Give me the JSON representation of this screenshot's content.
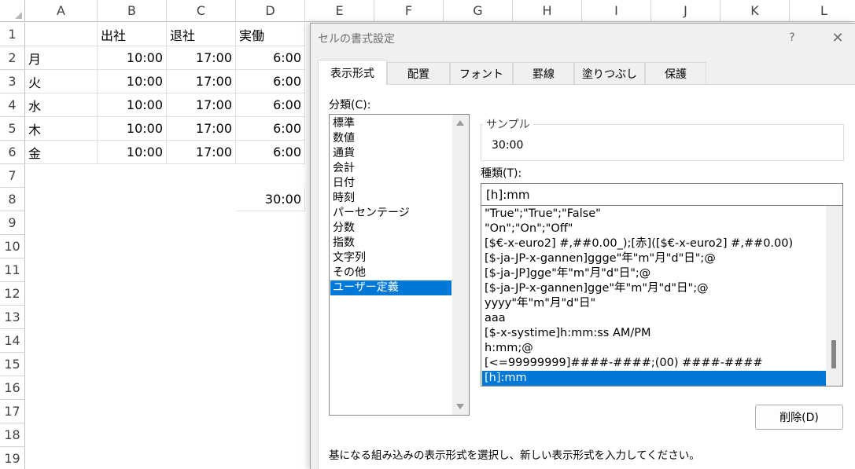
{
  "sheet": {
    "columns": [
      "A",
      "B",
      "C",
      "D",
      "E",
      "F",
      "G",
      "H",
      "I",
      "J",
      "K",
      "L"
    ],
    "rows": [
      "1",
      "2",
      "3",
      "4",
      "5",
      "6",
      "7",
      "8",
      "9",
      "10",
      "11",
      "12",
      "13",
      "14",
      "15",
      "16",
      "17",
      "18",
      "19"
    ],
    "headers": {
      "b": "出社",
      "c": "退社",
      "d": "実働"
    },
    "data": [
      {
        "a": "月",
        "b": "10:00",
        "c": "17:00",
        "d": "6:00"
      },
      {
        "a": "火",
        "b": "10:00",
        "c": "17:00",
        "d": "6:00"
      },
      {
        "a": "水",
        "b": "10:00",
        "c": "17:00",
        "d": "6:00"
      },
      {
        "a": "木",
        "b": "10:00",
        "c": "17:00",
        "d": "6:00"
      },
      {
        "a": "金",
        "b": "10:00",
        "c": "17:00",
        "d": "6:00"
      }
    ],
    "total": "30:00"
  },
  "dialog": {
    "title": "セルの書式設定",
    "help": "?",
    "close": "✕",
    "tabs": [
      "表示形式",
      "配置",
      "フォント",
      "罫線",
      "塗りつぶし",
      "保護"
    ],
    "active_tab": "表示形式",
    "category_label": "分類(C):",
    "categories": [
      "標準",
      "数値",
      "通貨",
      "会計",
      "日付",
      "時刻",
      "パーセンテージ",
      "分数",
      "指数",
      "文字列",
      "その他",
      "ユーザー定義"
    ],
    "selected_category": "ユーザー定義",
    "sample_label": "サンプル",
    "sample_value": "30:00",
    "type_label": "種類(T):",
    "type_value": "[h]:mm",
    "formats": [
      "\"True\";\"True\";\"False\"",
      "\"On\";\"On\";\"Off\"",
      "[$€-x-euro2] #,##0.00_);[赤]([$€-x-euro2] #,##0.00)",
      "[$-ja-JP-x-gannen]ggge\"年\"m\"月\"d\"日\";@",
      "[$-ja-JP]gge\"年\"m\"月\"d\"日\";@",
      "[$-ja-JP-x-gannen]gge\"年\"m\"月\"d\"日\";@",
      "yyyy\"年\"m\"月\"d\"日\"",
      "aaa",
      "[$-x-systime]h:mm:ss AM/PM",
      "h:mm;@",
      "[<=99999999]####-####;(00) ####-####",
      "[h]:mm"
    ],
    "selected_format": "[h]:mm",
    "delete_label": "削除(D)",
    "hint": "基になる組み込みの表示形式を選択し、新しい表示形式を入力してください。"
  },
  "colors": {
    "selection": "#0078d7",
    "dialog_bg": "#f0f0f0"
  },
  "icons": {
    "help": "help-icon",
    "close": "close-icon",
    "scroll_up": "scroll-up-icon",
    "scroll_down": "scroll-down-icon"
  }
}
